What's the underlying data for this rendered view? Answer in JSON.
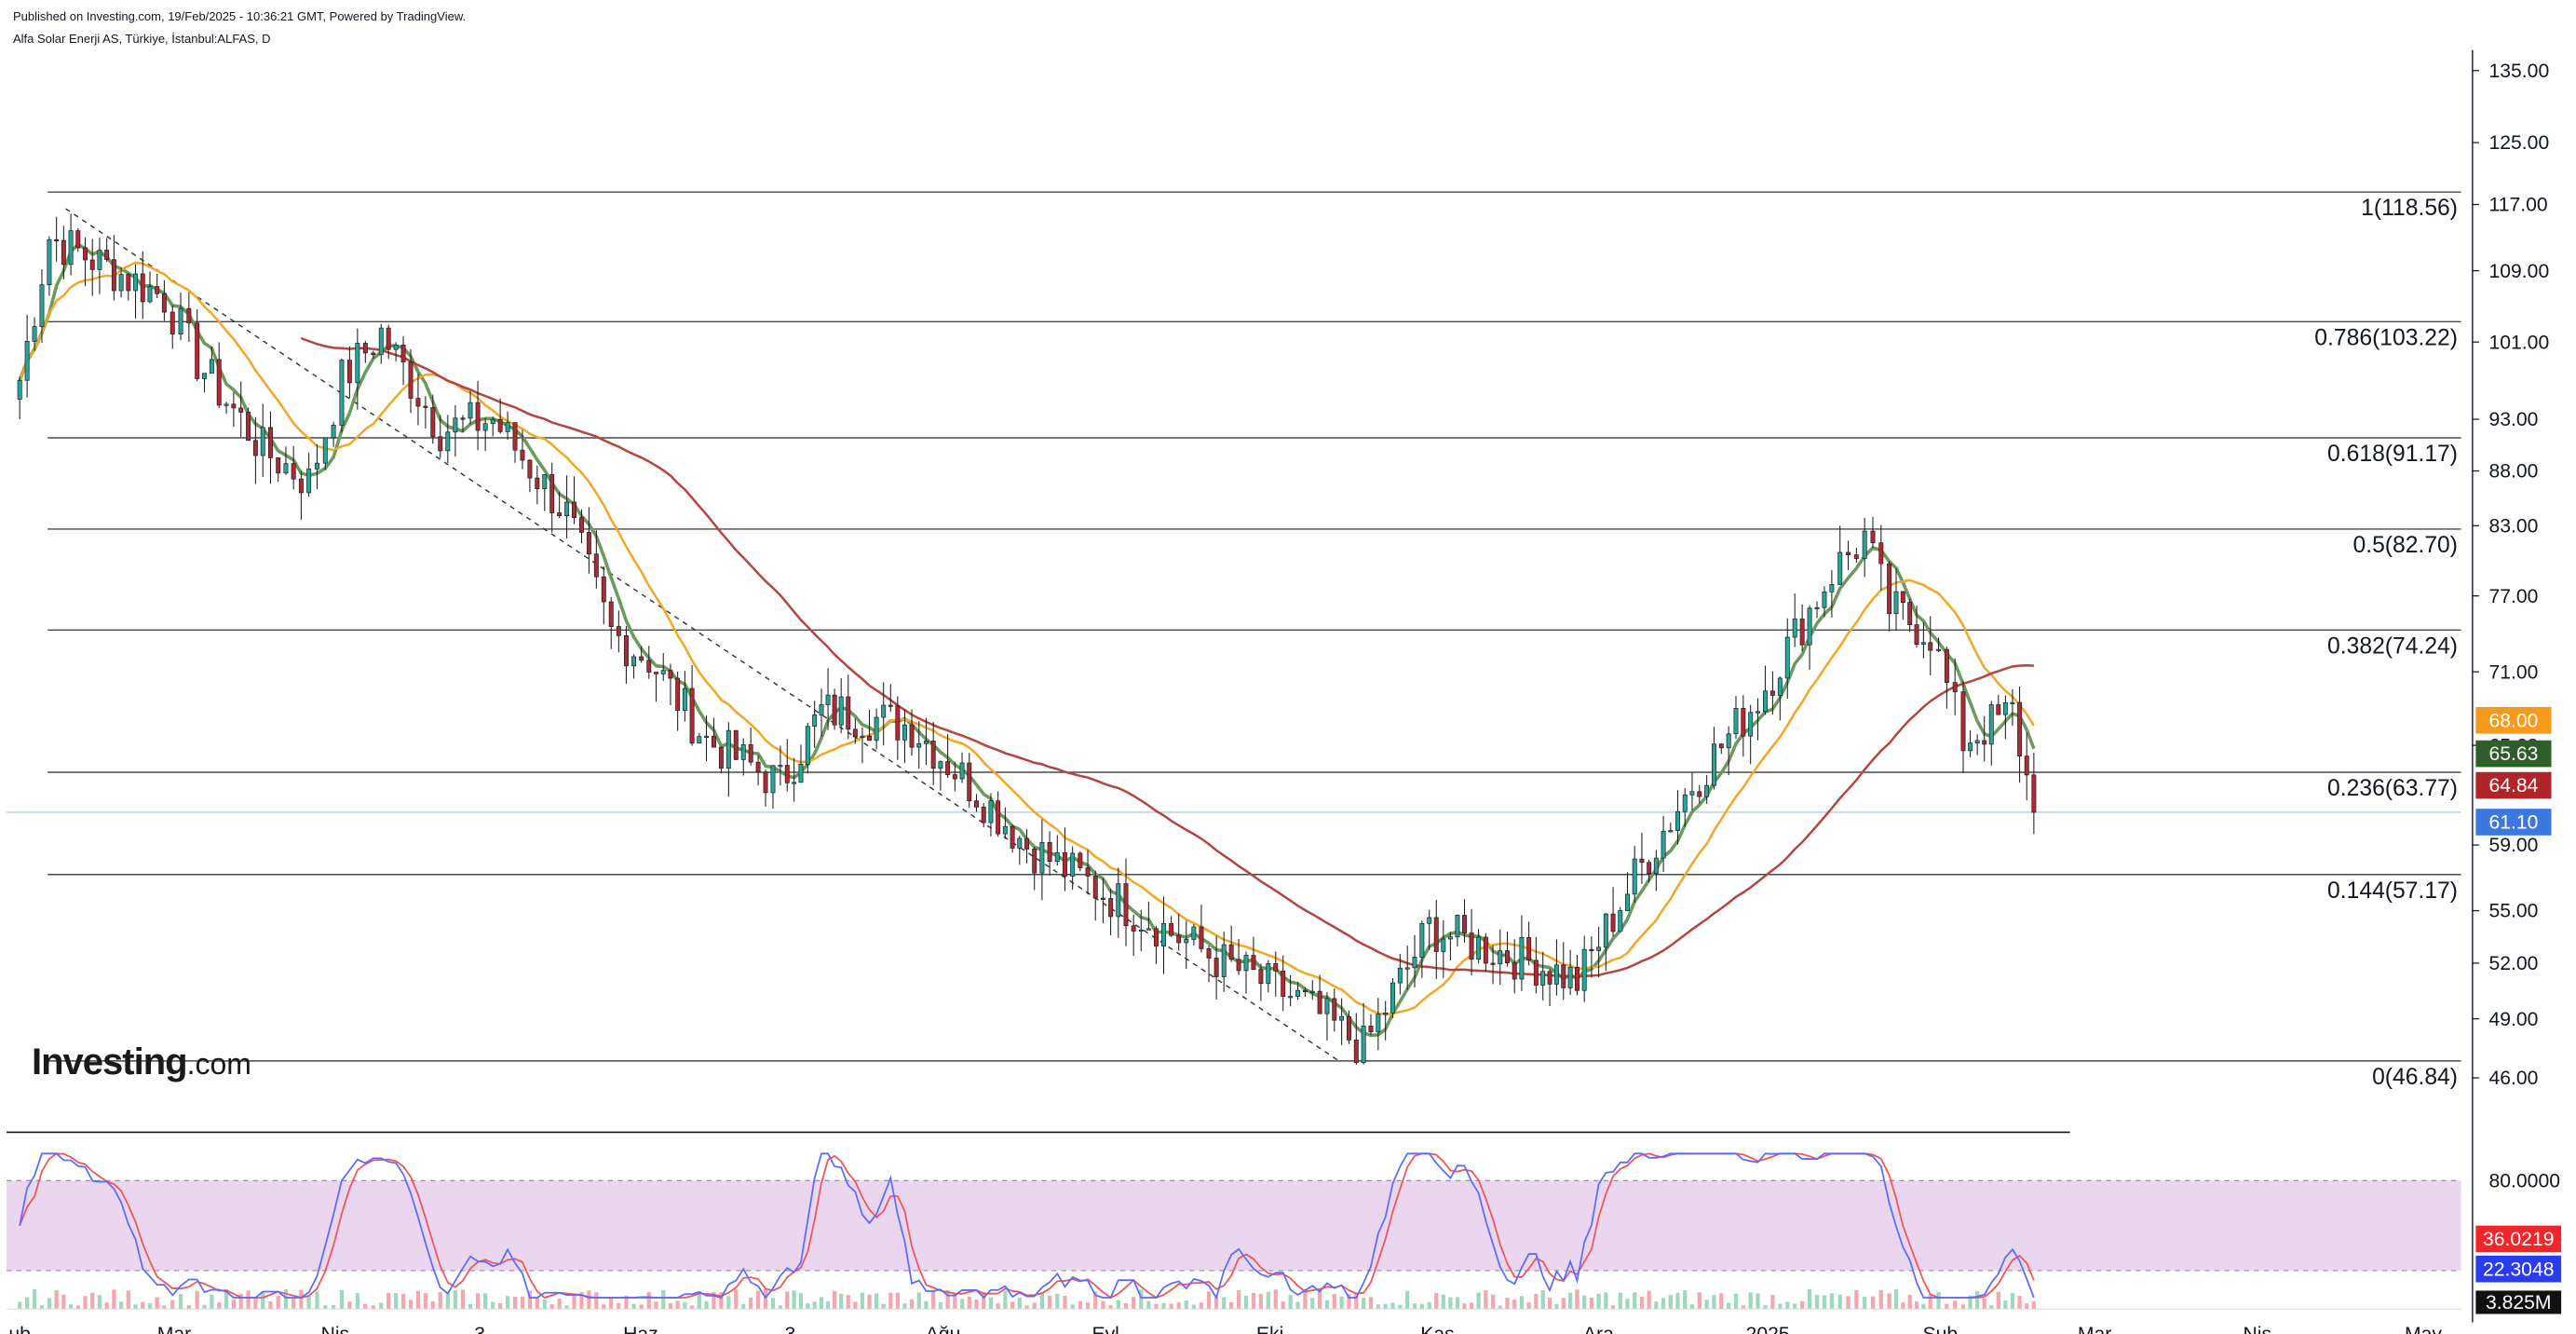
{
  "header": {
    "published": "Published on Investing.com, 19/Feb/2025 - 10:36:21 GMT, Powered by TradingView.",
    "symbol": "Alfa Solar Enerji AS, Türkiye, İstanbul:ALFAS, D"
  },
  "logo": {
    "brand": "Investing",
    "suffix": ".com"
  },
  "colors": {
    "bull": "#26a69a",
    "bear": "#b22833",
    "ma_fast": "#6a9a5c",
    "ma_mid": "#f5a623",
    "ma_slow": "#b5453f",
    "fib": "#4a4a4a",
    "stoch_k": "#5b6cff",
    "stoch_d": "#f2545b",
    "stoch_band": "#e3c8e8",
    "last_price": "#3d78e0"
  },
  "chart_data": [
    {
      "type": "candlestick",
      "title": "Alfa Solar Enerji AS, Türkiye, İstanbul:ALFAS, D",
      "x_tick_labels": [
        "ub",
        "Mar",
        "Nis",
        "3",
        "Haz",
        "3",
        "Ağu",
        "Eyl",
        "Eki",
        "Kas",
        "Ara",
        "2025",
        "Şub",
        "Mar",
        "Nis",
        "May"
      ],
      "y_tick_labels": [
        "135.00",
        "125.00",
        "117.00",
        "109.00",
        "101.00",
        "93.00",
        "88.00",
        "83.00",
        "77.00",
        "71.00",
        "65.63",
        "59.00",
        "55.00",
        "52.00",
        "49.00",
        "46.00"
      ],
      "y_scale": "log",
      "ylim": [
        44.5,
        138
      ],
      "fibonacci_levels": [
        {
          "label": "1(118.56)",
          "value": 118.56
        },
        {
          "label": "0.786(103.22)",
          "value": 103.22
        },
        {
          "label": "0.618(91.17)",
          "value": 91.17
        },
        {
          "label": "0.5(82.70)",
          "value": 82.7
        },
        {
          "label": "0.382(74.24)",
          "value": 74.24
        },
        {
          "label": "0.236(63.77)",
          "value": 63.77
        },
        {
          "label": "0.144(57.17)",
          "value": 57.17
        },
        {
          "label": "0(46.84)",
          "value": 46.84
        }
      ],
      "close_path": [
        [
          "ub",
          97
        ],
        [
          "ub",
          113
        ],
        [
          "Mar",
          106
        ],
        [
          "Mar",
          99
        ],
        [
          "Mar",
          90
        ],
        [
          "Nis",
          87
        ],
        [
          "Nis",
          97
        ],
        [
          "Nis",
          102
        ],
        [
          "3",
          92
        ],
        [
          "3",
          93
        ],
        [
          "Haz",
          84
        ],
        [
          "Haz",
          74
        ],
        [
          "Haz",
          72
        ],
        [
          "Haz",
          66
        ],
        [
          "3",
          63
        ],
        [
          "3",
          68
        ],
        [
          "3",
          68
        ],
        [
          "Ağu",
          67
        ],
        [
          "Ağu",
          63
        ],
        [
          "Eyl",
          59
        ],
        [
          "Eyl",
          55
        ],
        [
          "Eki",
          52
        ],
        [
          "Eki",
          50
        ],
        [
          "Eki",
          47.5
        ],
        [
          "Kas",
          54
        ],
        [
          "Kas",
          53
        ],
        [
          "Ara",
          52
        ],
        [
          "Ara",
          51
        ],
        [
          "Ara",
          57
        ],
        [
          "2025",
          63
        ],
        [
          "2025",
          69
        ],
        [
          "2025",
          79
        ],
        [
          "2025",
          82
        ],
        [
          "2025",
          76
        ],
        [
          "Şub",
          74
        ],
        [
          "Şub",
          66
        ],
        [
          "Şub",
          68
        ],
        [
          "Şub",
          61.1
        ]
      ],
      "price_badges": [
        {
          "label": "68.00",
          "color": "#f59a1b"
        },
        {
          "label": "65.63",
          "color": "#2e5f2a"
        },
        {
          "label": "64.84",
          "color": "#b0252a"
        },
        {
          "label": "61.10",
          "color": "#3d78e0"
        }
      ],
      "series": [
        {
          "type": "moving_average",
          "color": "#6a9a5c"
        },
        {
          "type": "moving_average",
          "color": "#f5a623"
        },
        {
          "type": "moving_average",
          "color": "#b5453f"
        }
      ]
    },
    {
      "type": "line",
      "y_tick_labels": [
        "80.0000"
      ],
      "overbought": 80,
      "oversold": 20,
      "ylim": [
        0,
        100
      ],
      "last_values": [
        {
          "label": "36.0219",
          "color": "#f2252a"
        },
        {
          "label": "22.3048",
          "color": "#2a3cf0"
        }
      ],
      "volume_last_label": "3.825M"
    }
  ]
}
